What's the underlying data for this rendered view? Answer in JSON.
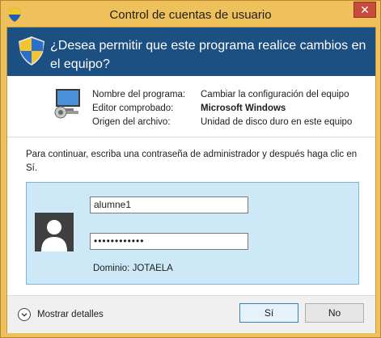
{
  "window": {
    "title": "Control de cuentas de usuario",
    "close_glyph": "✕"
  },
  "header": {
    "question": "¿Desea permitir que este programa realice cambios en el equipo?"
  },
  "info": {
    "rows": [
      {
        "label": "Nombre del programa:",
        "value": "Cambiar la configuración del equipo"
      },
      {
        "label": "Editor comprobado:",
        "value": "Microsoft Windows"
      },
      {
        "label": "Origen del archivo:",
        "value": "Unidad de disco duro en este equipo"
      }
    ]
  },
  "prompt": "Para continuar, escriba una contraseña de administrador y después haga clic en Sí.",
  "credentials": {
    "username": "alumne1",
    "password_mask": "••••••••••••",
    "domain": "Dominio: JOTAELA"
  },
  "footer": {
    "details_label": "Mostrar detalles",
    "yes_label": "Sí",
    "no_label": "No"
  },
  "colors": {
    "frame": "#eec15a",
    "header_bg": "#1c4f82",
    "cred_bg": "#cde8f6",
    "close_bg": "#c74c3c"
  }
}
